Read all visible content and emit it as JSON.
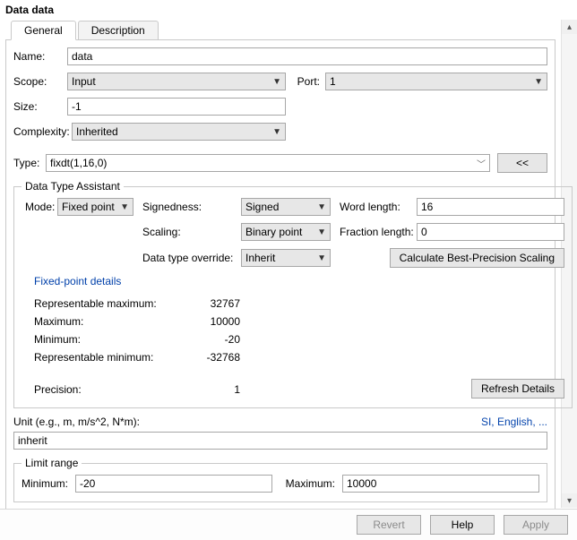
{
  "window_title": "Data data",
  "tabs": {
    "general": "General",
    "description": "Description"
  },
  "labels": {
    "name": "Name:",
    "scope": "Scope:",
    "port": "Port:",
    "size": "Size:",
    "complexity": "Complexity:",
    "type": "Type:",
    "collapse": "<<",
    "dta_legend": "Data Type Assistant",
    "mode": "Mode:",
    "signedness": "Signedness:",
    "scaling": "Scaling:",
    "word_length": "Word length:",
    "fraction_length": "Fraction length:",
    "dt_override": "Data type override:",
    "calc_best": "Calculate Best-Precision Scaling",
    "fp_details": "Fixed-point details",
    "rep_max": "Representable maximum:",
    "maximum": "Maximum:",
    "minimum": "Minimum:",
    "rep_min": "Representable minimum:",
    "precision": "Precision:",
    "refresh": "Refresh Details",
    "unit": "Unit (e.g., m, m/s^2, N*m):",
    "unit_link": "SI, English, ...",
    "limit_legend": "Limit range",
    "lr_min": "Minimum:",
    "lr_max": "Maximum:",
    "revert": "Revert",
    "help": "Help",
    "apply": "Apply"
  },
  "values": {
    "name": "data",
    "scope": "Input",
    "port": "1",
    "size": "-1",
    "complexity": "Inherited",
    "type": "fixdt(1,16,0)",
    "mode": "Fixed point",
    "signedness": "Signed",
    "scaling": "Binary point",
    "word_length": "16",
    "fraction_length": "0",
    "dt_override": "Inherit",
    "rep_max": "32767",
    "max": "10000",
    "min": "-20",
    "rep_min": "-32768",
    "precision": "1",
    "unit": "inherit",
    "lr_min": "-20",
    "lr_max": "10000"
  }
}
